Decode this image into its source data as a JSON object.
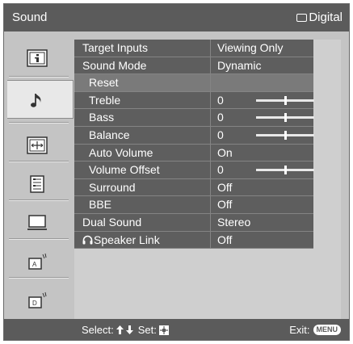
{
  "header": {
    "title": "Sound",
    "input_label": "Digital"
  },
  "menu": {
    "rows": [
      {
        "label": "Target Inputs",
        "value": "Viewing Only",
        "sub": false,
        "slider": null
      },
      {
        "label": "Sound Mode",
        "value": "Dynamic",
        "sub": false,
        "slider": null
      },
      {
        "label": "Reset",
        "value": "",
        "sub": true,
        "slider": null
      },
      {
        "label": "Treble",
        "value": "0",
        "sub": true,
        "slider": 0.5
      },
      {
        "label": "Bass",
        "value": "0",
        "sub": true,
        "slider": 0.5
      },
      {
        "label": "Balance",
        "value": "0",
        "sub": true,
        "slider": 0.5
      },
      {
        "label": "Auto Volume",
        "value": "On",
        "sub": true,
        "slider": null
      },
      {
        "label": "Volume Offset",
        "value": "0",
        "sub": true,
        "slider": 0.5
      },
      {
        "label": "Surround",
        "value": "Off",
        "sub": true,
        "slider": null
      },
      {
        "label": "BBE",
        "value": "Off",
        "sub": true,
        "slider": null
      },
      {
        "label": "Dual Sound",
        "value": "Stereo",
        "sub": false,
        "slider": null
      },
      {
        "label": "Speaker Link",
        "value": "Off",
        "sub": false,
        "slider": null,
        "icon": "headphone-icon"
      }
    ]
  },
  "footer": {
    "select_label": "Select:",
    "set_label": "Set:",
    "exit_label": "Exit:",
    "menu_key": "MENU"
  },
  "colors": {
    "bar": "#5b5b5b",
    "row": "#5e5e5e",
    "panel": "#c4c4c4"
  }
}
